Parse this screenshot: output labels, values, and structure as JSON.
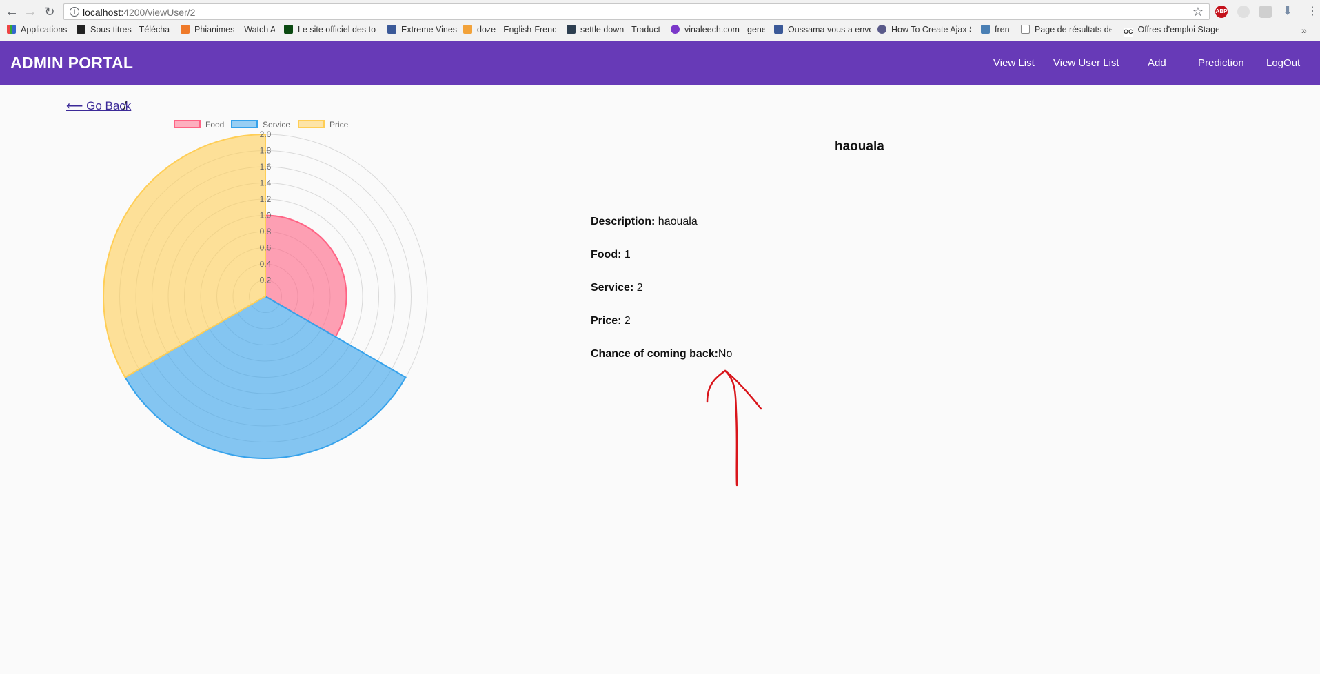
{
  "browser": {
    "url_host": "localhost:",
    "url_path": "4200/viewUser/2",
    "bookmarks": [
      "Applications",
      "Sous-titres - Télécha",
      "Phianimes – Watch A",
      "Le site officiel des to",
      "Extreme Vines",
      "doze - English-French",
      "settle down - Traduct",
      "vinaleech.com - gene",
      "Oussama vous a envo",
      "How To Create Ajax S",
      "fren",
      "Page de résultats de",
      "Offres d'emploi Stage"
    ]
  },
  "app": {
    "brand": "ADMIN PORTAL",
    "nav": [
      "View List",
      "View User List",
      "Add",
      "Prediction",
      "LogOut"
    ],
    "accent": "#673ab7"
  },
  "breadcrumb": {
    "back_arrow": "⟵",
    "back_label": " Go Back",
    "separator": "/"
  },
  "chart_data": {
    "type": "polarArea",
    "categories": [
      "Food",
      "Service",
      "Price"
    ],
    "values": [
      1,
      2,
      2
    ],
    "colors": [
      "#ff6384",
      "#36a2eb",
      "#ffce56"
    ],
    "rlim": [
      0,
      2.0
    ],
    "ticks": [
      "0.2",
      "0.4",
      "0.6",
      "0.8",
      "1.0",
      "1.2",
      "1.4",
      "1.6",
      "1.8",
      "2.0"
    ],
    "legend_position": "top"
  },
  "detail": {
    "title": "haouala",
    "description_label": "Description:",
    "description_value": " haouala",
    "food_label": "Food:",
    "food_value": " 1",
    "service_label": "Service:",
    "service_value": " 2",
    "price_label": "Price:",
    "price_value": " 2",
    "chance_label": "Chance of coming back:",
    "chance_value": "No"
  }
}
